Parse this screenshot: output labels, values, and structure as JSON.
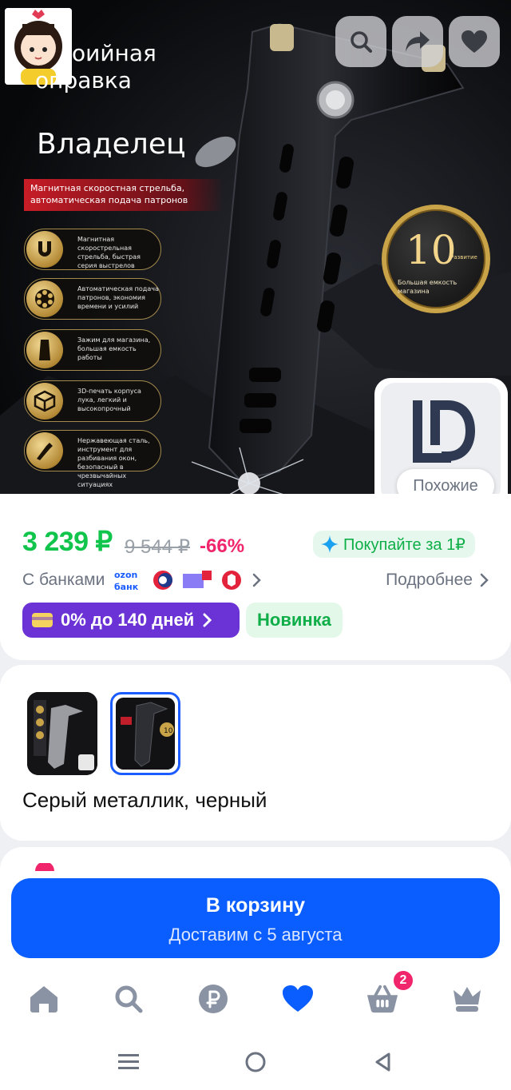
{
  "hero": {
    "title_line1": "оийная",
    "title_line2": "оправка",
    "subtitle": "Владелец",
    "red_banner": [
      "Магнитная скоростная стрельба,",
      "автоматическая подача патронов"
    ],
    "features": [
      {
        "icon": "magnet-icon",
        "text": "Магнитная скорострельная стрельба, быстрая серия выстрелов"
      },
      {
        "icon": "revolver-cylinder-icon",
        "text": "Автоматическая подача патронов, экономия времени и усилий"
      },
      {
        "icon": "magazine-clip-icon",
        "text": "Зажим для магазина, большая емкость работы"
      },
      {
        "icon": "3d-cube-icon",
        "text": "3D-печать корпуса лука, легкий и высокопрочный"
      },
      {
        "icon": "hammer-icon",
        "text": "Нержавеющая сталь, инструмент для разбивания окон, безопасный в чрезвычайных ситуациях"
      }
    ],
    "coin": {
      "number": "10",
      "sub": "Развитие",
      "caption": "Большая емкость магазина"
    },
    "similar_label": "Похожие",
    "top_icons": [
      "back-icon",
      "search-icon",
      "share-icon",
      "heart-icon"
    ]
  },
  "price": {
    "current": "3 239 ₽",
    "old": "9 544 ₽",
    "discount": "-66%",
    "promo": "Покупайте за 1₽",
    "banks_label": "С банками",
    "banks_more": "Подробнее",
    "installment": "0% до 140 дней",
    "new_badge": "Новинка"
  },
  "variant": {
    "name": "Серый металлик, черный"
  },
  "cart": {
    "label": "В корзину",
    "delivery": "Доставим с 5 августа"
  },
  "tabbar": {
    "items": [
      "home-icon",
      "search-icon",
      "ruble-icon",
      "heart-icon",
      "cart-icon",
      "crown-icon"
    ],
    "active": "heart-icon",
    "cart_badge": "2"
  },
  "colors": {
    "accent_blue": "#0a5dff",
    "price_green": "#10c44c",
    "discount_pink": "#f0256b",
    "installment_purple": "#6b33d6"
  }
}
